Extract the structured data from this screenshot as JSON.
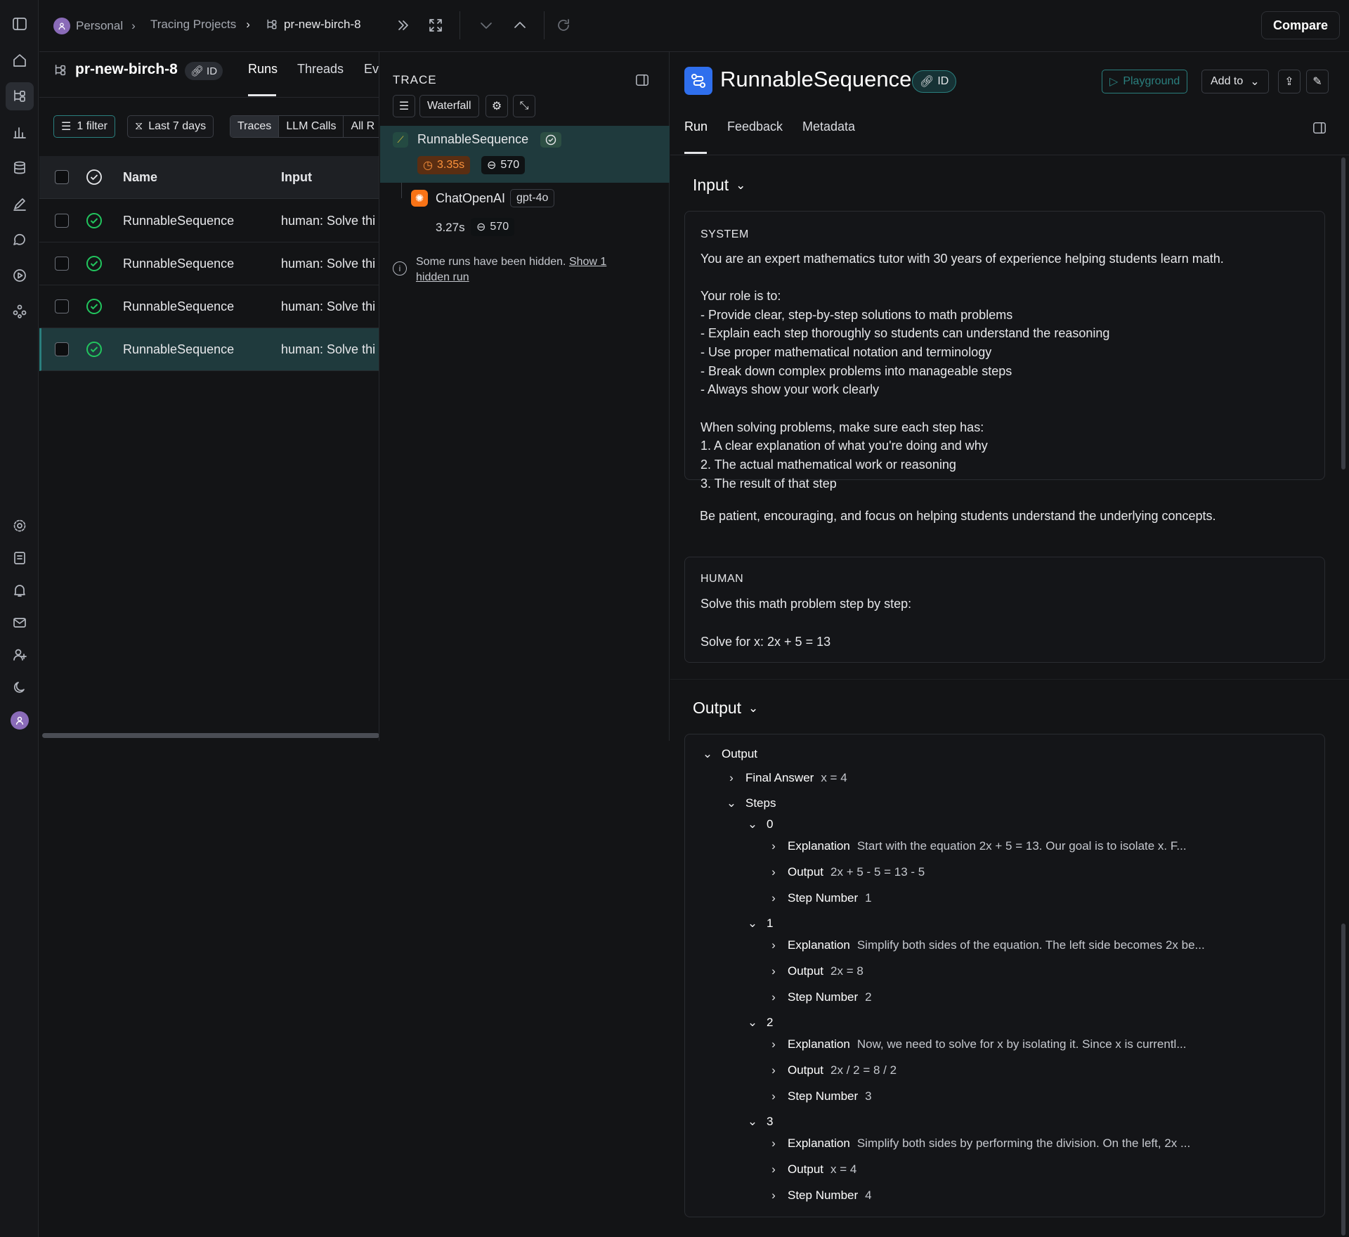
{
  "breadcrumb": {
    "org": "Personal",
    "section": "Tracing Projects",
    "project": "pr-new-birch-8"
  },
  "compare_label": "Compare",
  "runs_panel": {
    "project_name": "pr-new-birch-8",
    "id_label": "ID",
    "tabs": [
      "Runs",
      "Threads",
      "Ev"
    ],
    "filter_label": "1 filter",
    "date_label": "Last 7 days",
    "segments": [
      "Traces",
      "LLM Calls",
      "All R"
    ],
    "columns": {
      "name": "Name",
      "input": "Input"
    },
    "rows": [
      {
        "name": "RunnableSequence",
        "input": "human: Solve thi"
      },
      {
        "name": "RunnableSequence",
        "input": "human: Solve thi"
      },
      {
        "name": "RunnableSequence",
        "input": "human: Solve thi"
      },
      {
        "name": "RunnableSequence",
        "input": "human: Solve thi"
      }
    ]
  },
  "trace_panel": {
    "title": "TRACE",
    "view_label": "Waterfall",
    "root": {
      "name": "RunnableSequence",
      "latency": "3.35s",
      "tokens": "570"
    },
    "child": {
      "name": "ChatOpenAI",
      "model": "gpt-4o",
      "latency": "3.27s",
      "tokens": "570"
    },
    "hidden_note": "Some runs have been hidden.",
    "hidden_link_1": "Show 1",
    "hidden_link_2": "hidden run"
  },
  "detail": {
    "title": "RunnableSequence",
    "id_label": "ID",
    "playground_label": "Playground",
    "add_to_label": "Add to",
    "tabs": [
      "Run",
      "Feedback",
      "Metadata"
    ],
    "input_heading": "Input",
    "output_heading": "Output",
    "system_label": "SYSTEM",
    "system_lines": [
      "You are an expert mathematics tutor with 30 years of experience helping students learn math.",
      "",
      "Your role is to:",
      "- Provide clear, step-by-step solutions to math problems",
      "- Explain each step thoroughly so students can understand the reasoning",
      "- Use proper mathematical notation and terminology",
      "- Break down complex problems into manageable steps",
      "- Always show your work clearly",
      "",
      "When solving problems, make sure each step has:",
      "1. A clear explanation of what you're doing and why",
      "2. The actual mathematical work or reasoning",
      "3. The result of that step",
      "",
      "Be patient, encouraging, and focus on helping students understand the underlying concepts."
    ],
    "human_label": "HUMAN",
    "human_lines": [
      "Solve this math problem step by step:",
      "",
      "Solve for x: 2x + 5 = 13"
    ],
    "output_tree": {
      "root": "Output",
      "final_answer": {
        "key": "Final Answer",
        "value": "x = 4"
      },
      "steps_key": "Steps",
      "steps": [
        {
          "index": "0",
          "explanation": "Start with the equation 2x + 5 = 13. Our goal is to isolate x. F...",
          "output": "2x + 5 - 5 = 13 - 5",
          "step_number": "1"
        },
        {
          "index": "1",
          "explanation": "Simplify both sides of the equation. The left side becomes 2x be...",
          "output": "2x = 8",
          "step_number": "2"
        },
        {
          "index": "2",
          "explanation": "Now, we need to solve for x by isolating it. Since x is currentl...",
          "output": "2x / 2 = 8 / 2",
          "step_number": "3"
        },
        {
          "index": "3",
          "explanation": "Simplify both sides by performing the division. On the left, 2x ...",
          "output": "x = 4",
          "step_number": "4"
        }
      ],
      "labels": {
        "explanation": "Explanation",
        "output": "Output",
        "step_number": "Step Number"
      }
    }
  },
  "colors": {
    "accent_teal": "#1f3a3d",
    "success_green": "#22c55e",
    "latency_orange": "#f97316",
    "brand_blue": "#2f6fed"
  }
}
